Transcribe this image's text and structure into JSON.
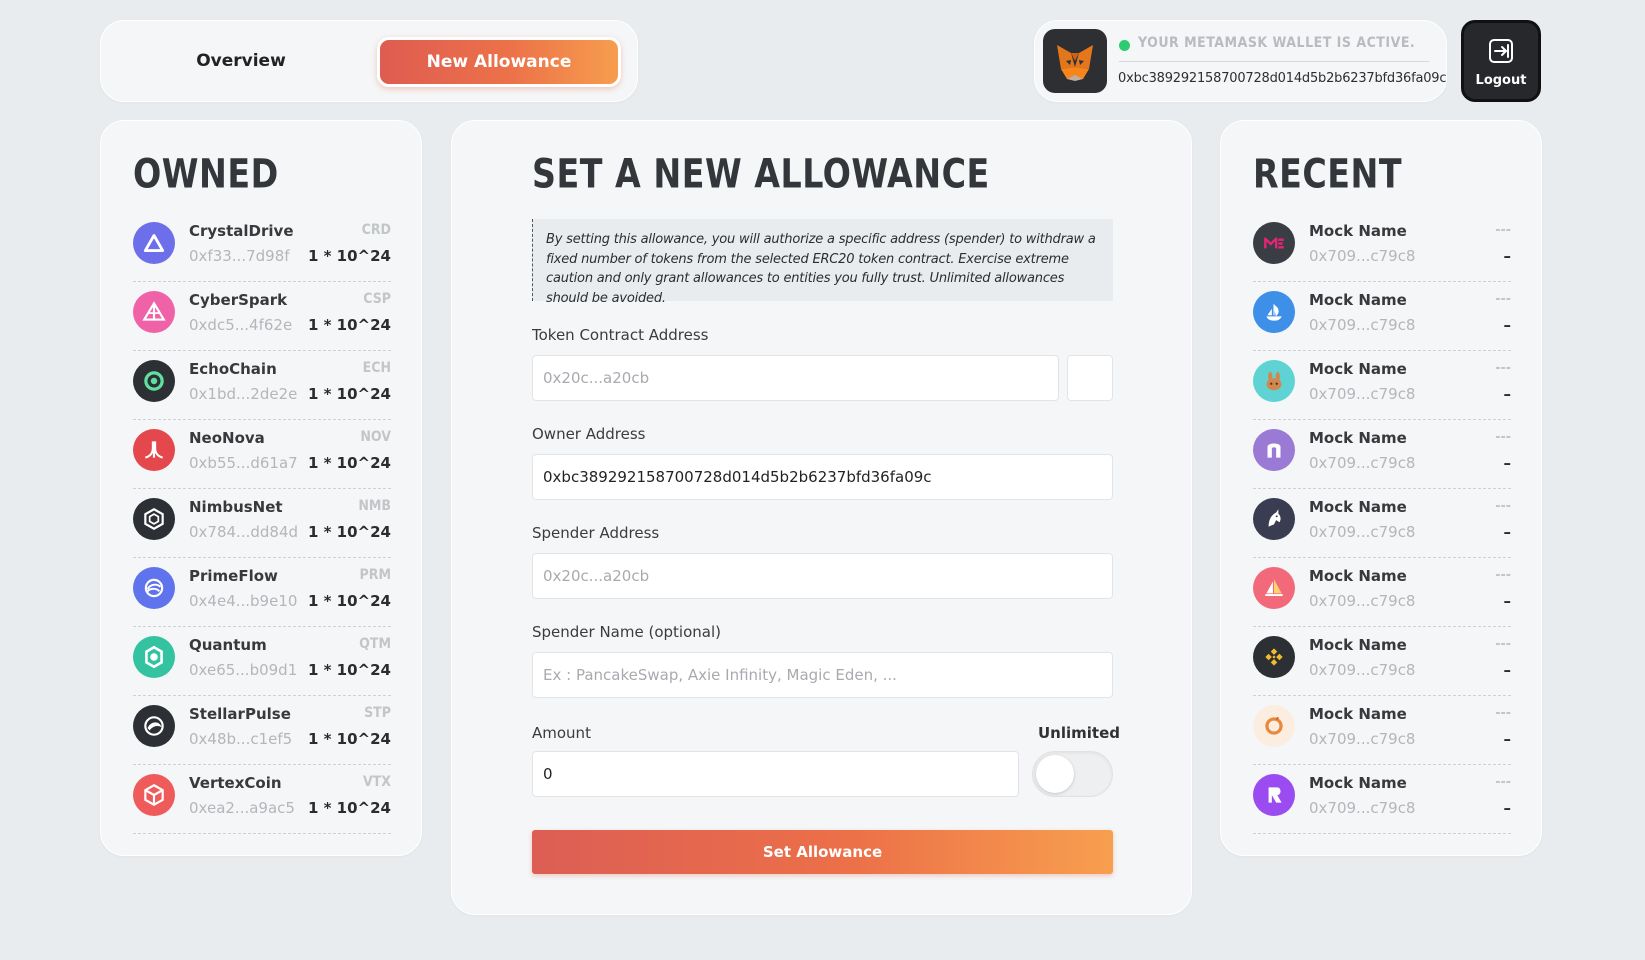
{
  "nav": {
    "overview_label": "Overview",
    "new_allowance_label": "New Allowance"
  },
  "wallet": {
    "status": "YOUR METAMASK WALLET IS ACTIVE.",
    "address": "0xbc389292158700728d014d5b2b6237bfd36fa09c",
    "logout_label": "Logout"
  },
  "owned": {
    "title": "OWNED",
    "items": [
      {
        "name": "CrystalDrive",
        "address": "0xf33...7d98f",
        "symbol": "CRD",
        "amount": "1 * 10^24",
        "icon": "triangle-icon",
        "color": "#6c6fe9"
      },
      {
        "name": "CyberSpark",
        "address": "0xdc5...4f62e",
        "symbol": "CSP",
        "amount": "1 * 10^24",
        "icon": "prism-icon",
        "color": "#f062a8"
      },
      {
        "name": "EchoChain",
        "address": "0x1bd...2de2e",
        "symbol": "ECH",
        "amount": "1 * 10^24",
        "icon": "ring-icon",
        "color": "#2c2f33"
      },
      {
        "name": "NeoNova",
        "address": "0xb55...d61a7",
        "symbol": "NOV",
        "amount": "1 * 10^24",
        "icon": "atari-icon",
        "color": "#e4474c"
      },
      {
        "name": "NimbusNet",
        "address": "0x784...dd84d",
        "symbol": "NMB",
        "amount": "1 * 10^24",
        "icon": "hexagon-icon",
        "color": "#2c2f33"
      },
      {
        "name": "PrimeFlow",
        "address": "0x4e4...b9e10",
        "symbol": "PRM",
        "amount": "1 * 10^24",
        "icon": "swirl-icon",
        "color": "#5f74ec"
      },
      {
        "name": "Quantum",
        "address": "0xe65...b09d1",
        "symbol": "QTM",
        "amount": "1 * 10^24",
        "icon": "gem-icon",
        "color": "#33c3a0"
      },
      {
        "name": "StellarPulse",
        "address": "0x48b...c1ef5",
        "symbol": "STP",
        "amount": "1 * 10^24",
        "icon": "bird-icon",
        "color": "#2c2f33"
      },
      {
        "name": "VertexCoin",
        "address": "0xea2...a9ac5",
        "symbol": "VTX",
        "amount": "1 * 10^24",
        "icon": "cube-icon",
        "color": "#ef5a5a"
      }
    ]
  },
  "form": {
    "title": "SET A NEW ALLOWANCE",
    "disclaimer": "By setting this allowance, you will authorize a specific address (spender) to withdraw a fixed number of tokens from the selected ERC20 token contract. Exercise extreme caution and only grant allowances to entities you fully trust. Unlimited allowances should be avoided.",
    "token_label": "Token Contract Address",
    "token_placeholder": "0x20c...a20cb",
    "owner_label": "Owner Address",
    "owner_value": "0xbc389292158700728d014d5b2b6237bfd36fa09c",
    "spender_label": "Spender Address",
    "spender_placeholder": "0x20c...a20cb",
    "spender_name_label": "Spender Name (optional)",
    "spender_name_placeholder": "Ex : PancakeSwap, Axie Infinity, Magic Eden, ...",
    "amount_label": "Amount",
    "amount_value": "0",
    "unlimited_label": "Unlimited",
    "unlimited_on": false,
    "submit_label": "Set Allowance"
  },
  "recent": {
    "title": "RECENT",
    "items": [
      {
        "name": "Mock Name",
        "address": "0x709...c79c8",
        "symbol": "---",
        "amount": "–",
        "icon": "magic-eden-icon",
        "color": "#3a3d44"
      },
      {
        "name": "Mock Name",
        "address": "0x709...c79c8",
        "symbol": "---",
        "amount": "–",
        "icon": "opensea-icon",
        "color": "#3e8fe8"
      },
      {
        "name": "Mock Name",
        "address": "0x709...c79c8",
        "symbol": "---",
        "amount": "–",
        "icon": "pancake-bunny-icon",
        "color": "#5fd3d3"
      },
      {
        "name": "Mock Name",
        "address": "0x709...c79c8",
        "symbol": "---",
        "amount": "–",
        "icon": "arch-icon",
        "color": "#9b7ad6"
      },
      {
        "name": "Mock Name",
        "address": "0x709...c79c8",
        "symbol": "---",
        "amount": "–",
        "icon": "unicorn-icon",
        "color": "#3a3d52"
      },
      {
        "name": "Mock Name",
        "address": "0x709...c79c8",
        "symbol": "---",
        "amount": "–",
        "icon": "sail-icon",
        "color": "#f26a7a"
      },
      {
        "name": "Mock Name",
        "address": "0x709...c79c8",
        "symbol": "---",
        "amount": "–",
        "icon": "binance-icon",
        "color": "#2c2f33"
      },
      {
        "name": "Mock Name",
        "address": "0x709...c79c8",
        "symbol": "---",
        "amount": "–",
        "icon": "donut-icon",
        "color": "#fbeee1"
      },
      {
        "name": "Mock Name",
        "address": "0x709...c79c8",
        "symbol": "---",
        "amount": "–",
        "icon": "radiant-icon",
        "color": "#9b4cf0"
      }
    ]
  }
}
